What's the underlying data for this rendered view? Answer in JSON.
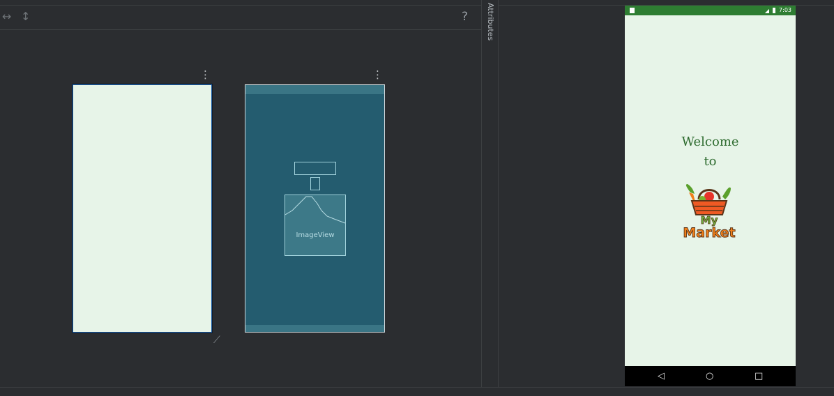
{
  "toolbar": {
    "horizontal_icon": "arrows-horizontal-icon",
    "vertical_icon": "arrows-vertical-icon",
    "help": "?"
  },
  "attributes_tab": {
    "label": "Attributes"
  },
  "blueprint": {
    "imageview_label": "ImageView"
  },
  "device": {
    "status_time": "7:03",
    "welcome_line1": "Welcome",
    "welcome_line2": "to",
    "logo_text_line1": "My",
    "logo_text_line2": "Market"
  },
  "colors": {
    "app_bg": "#e7f4e8",
    "status_bar": "#2e7d32",
    "welcome_text": "#2e6b2f",
    "blueprint_bg": "#245c6f",
    "logo_orange": "#f07f1a"
  }
}
